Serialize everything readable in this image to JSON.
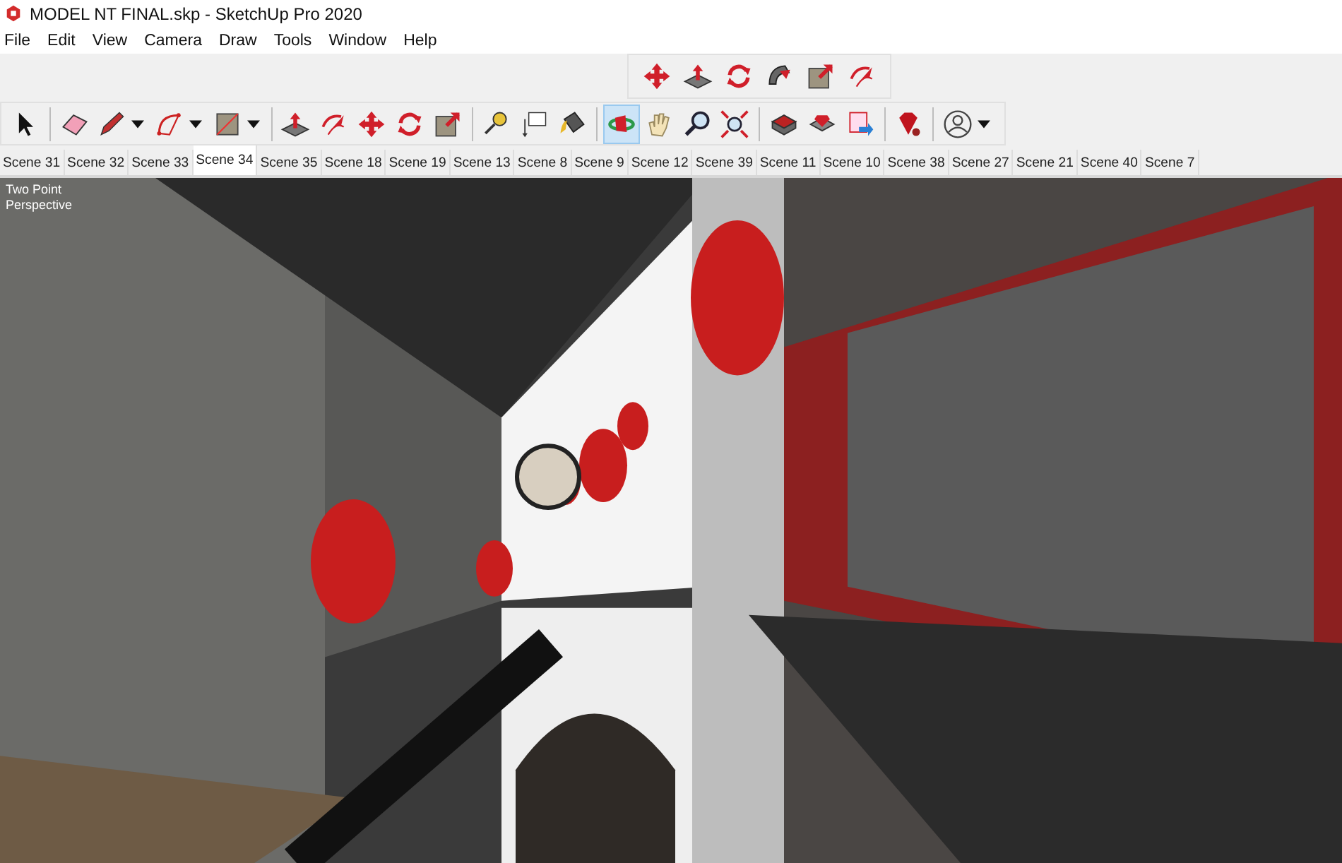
{
  "window": {
    "title": "MODEL NT FINAL.skp - SketchUp Pro 2020"
  },
  "menu": [
    "File",
    "Edit",
    "View",
    "Camera",
    "Draw",
    "Tools",
    "Window",
    "Help"
  ],
  "toolbar_top": [
    {
      "kind": "move",
      "selected": false
    },
    {
      "kind": "pushpull",
      "selected": false
    },
    {
      "kind": "rotate",
      "selected": false
    },
    {
      "kind": "followme",
      "selected": false
    },
    {
      "kind": "scale",
      "selected": false
    },
    {
      "kind": "offset",
      "selected": false
    }
  ],
  "toolbar_main": [
    {
      "kind": "select",
      "selected": false
    },
    {
      "kind": "sep"
    },
    {
      "kind": "eraser",
      "selected": false
    },
    {
      "kind": "pencil",
      "selected": false
    },
    {
      "kind": "dropdown"
    },
    {
      "kind": "arc",
      "selected": false
    },
    {
      "kind": "dropdown"
    },
    {
      "kind": "rectangle",
      "selected": false
    },
    {
      "kind": "dropdown"
    },
    {
      "kind": "sep"
    },
    {
      "kind": "pushpull",
      "selected": false
    },
    {
      "kind": "offset",
      "selected": false
    },
    {
      "kind": "move",
      "selected": false
    },
    {
      "kind": "rotate",
      "selected": false
    },
    {
      "kind": "scale",
      "selected": false
    },
    {
      "kind": "sep"
    },
    {
      "kind": "tape",
      "selected": false
    },
    {
      "kind": "text",
      "selected": false
    },
    {
      "kind": "paint",
      "selected": false
    },
    {
      "kind": "sep"
    },
    {
      "kind": "orbit",
      "selected": true
    },
    {
      "kind": "pan",
      "selected": false
    },
    {
      "kind": "zoom",
      "selected": false
    },
    {
      "kind": "extents",
      "selected": false
    },
    {
      "kind": "sep"
    },
    {
      "kind": "warehouse",
      "selected": false
    },
    {
      "kind": "extension",
      "selected": false
    },
    {
      "kind": "share",
      "selected": false
    },
    {
      "kind": "sep"
    },
    {
      "kind": "ruby",
      "selected": false
    },
    {
      "kind": "sep"
    },
    {
      "kind": "account",
      "selected": false
    },
    {
      "kind": "dropdown"
    }
  ],
  "scene_tabs": [
    {
      "label": "Scene 31",
      "selected": false
    },
    {
      "label": "Scene 32",
      "selected": false
    },
    {
      "label": "Scene 33",
      "selected": false
    },
    {
      "label": "Scene 34",
      "selected": true
    },
    {
      "label": "Scene 35",
      "selected": false
    },
    {
      "label": "Scene 18",
      "selected": false
    },
    {
      "label": "Scene 19",
      "selected": false
    },
    {
      "label": "Scene 13",
      "selected": false
    },
    {
      "label": "Scene 8",
      "selected": false
    },
    {
      "label": "Scene 9",
      "selected": false
    },
    {
      "label": "Scene 12",
      "selected": false
    },
    {
      "label": "Scene 39",
      "selected": false
    },
    {
      "label": "Scene 11",
      "selected": false
    },
    {
      "label": "Scene 10",
      "selected": false
    },
    {
      "label": "Scene 38",
      "selected": false
    },
    {
      "label": "Scene 27",
      "selected": false
    },
    {
      "label": "Scene 21",
      "selected": false
    },
    {
      "label": "Scene 40",
      "selected": false
    },
    {
      "label": "Scene 7",
      "selected": false
    }
  ],
  "viewport": {
    "camera_label": "Two Point\nPerspective"
  }
}
